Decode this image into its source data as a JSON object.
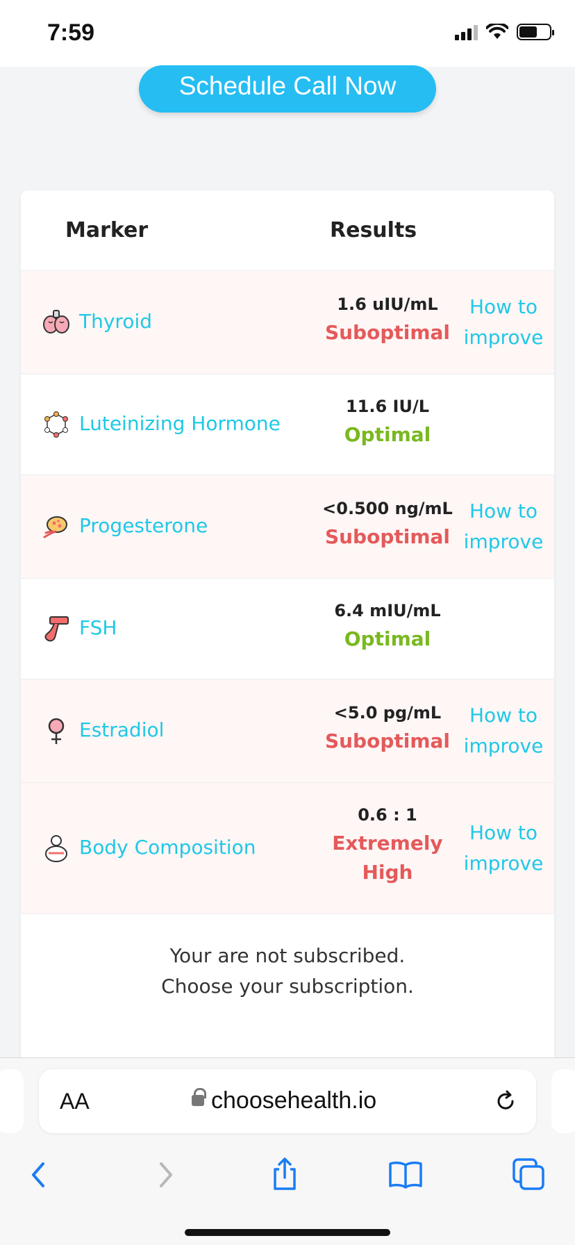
{
  "status_bar": {
    "time": "7:59"
  },
  "schedule_button": "Schedule Call Now",
  "table": {
    "headers": {
      "marker": "Marker",
      "results": "Results"
    },
    "rows": [
      {
        "name": "Thyroid",
        "icon": "thyroid-icon",
        "value": "1.6 uIU/mL",
        "status": "Suboptimal",
        "improve": "How to improve"
      },
      {
        "name": "Luteinizing Hormone",
        "icon": "molecule-icon",
        "value": "11.6 IU/L",
        "status": "Optimal",
        "improve": ""
      },
      {
        "name": "Progesterone",
        "icon": "ovary-icon",
        "value": "<0.500 ng/mL",
        "status": "Suboptimal",
        "improve": "How to improve"
      },
      {
        "name": "FSH",
        "icon": "fsh-icon",
        "value": "6.4 mIU/mL",
        "status": "Optimal",
        "improve": ""
      },
      {
        "name": "Estradiol",
        "icon": "female-symbol-icon",
        "value": "<5.0 pg/mL",
        "status": "Suboptimal",
        "improve": "How to improve"
      },
      {
        "name": "Body Composition",
        "icon": "body-icon",
        "value": "0.6 : 1",
        "status": "Extremely High",
        "improve": "How to improve"
      }
    ]
  },
  "subscription": {
    "line1": "Your are not subscribed.",
    "line2": "Choose your subscription."
  },
  "browser": {
    "text_size": "AA",
    "url": "choosehealth.io"
  },
  "colors": {
    "accent": "#1fc8e6",
    "button": "#26bdf2",
    "suboptimal": "#e45a5a",
    "optimal": "#79b81f",
    "ios_blue": "#1a7cf5"
  }
}
